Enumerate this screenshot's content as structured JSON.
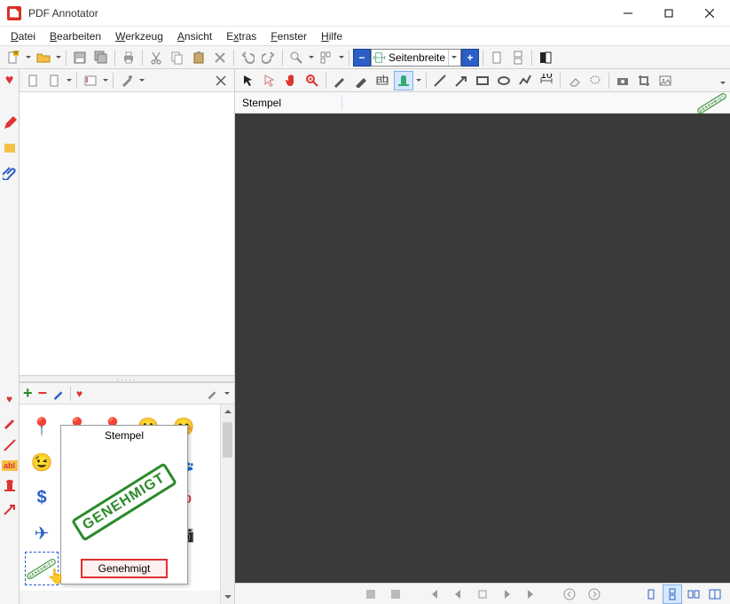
{
  "app": {
    "title": "PDF Annotator"
  },
  "win": {
    "min": "–",
    "max": "☐",
    "close": "✕"
  },
  "menu": {
    "file": "Datei",
    "edit": "Bearbeiten",
    "tool": "Werkzeug",
    "view": "Ansicht",
    "extras": "Extras",
    "window": "Fenster",
    "help": "Hilfe"
  },
  "zoom": {
    "mode": "Seitenbreite",
    "minus": "−",
    "plus": "+"
  },
  "label": {
    "stempel": "Stempel"
  },
  "popup": {
    "title": "Stempel",
    "stamp_text": "GENEHMIGT",
    "caption": "Genehmigt"
  },
  "stamps": {
    "row1": [
      "📍",
      "📍",
      "📍",
      "😀",
      "😊"
    ],
    "row2": [
      "😉",
      "",
      "",
      "",
      "🐾"
    ],
    "row3": [
      "$",
      "",
      "",
      "",
      "%"
    ],
    "row4": [
      "✈",
      "",
      "",
      "",
      "📷"
    ]
  },
  "colors": {
    "accent_green": "#2a8a2a",
    "accent_red": "#e03030",
    "accent_blue": "#2b5fc7"
  }
}
